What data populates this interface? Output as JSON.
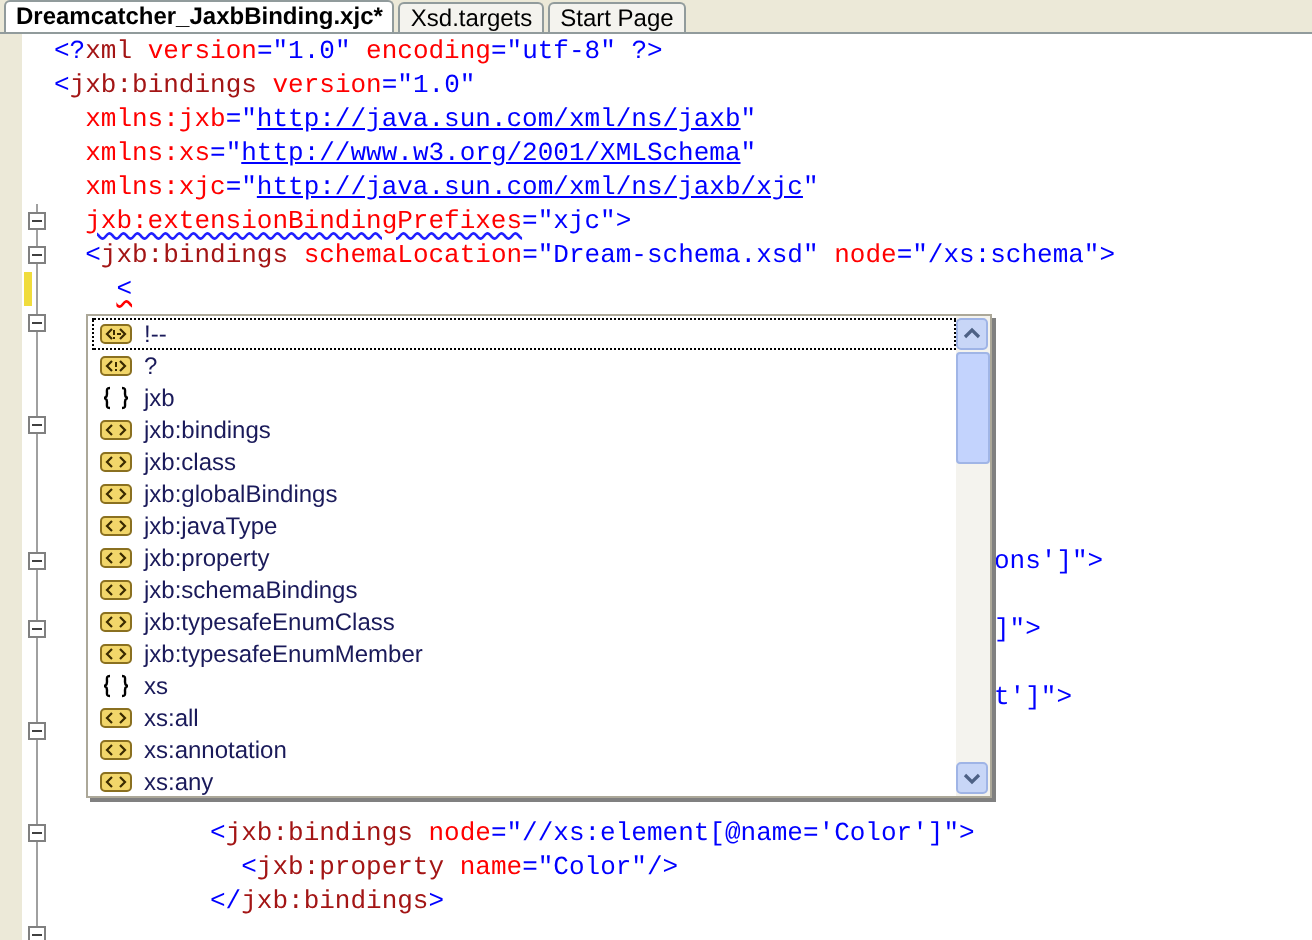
{
  "tabs": [
    {
      "label": "Dreamcatcher_JaxbBinding.xjc*",
      "selected": true
    },
    {
      "label": "Xsd.targets",
      "selected": false
    },
    {
      "label": "Start Page",
      "selected": false
    }
  ],
  "lines": [
    {
      "kind": "top",
      "tokens": [
        {
          "kind": "delim",
          "text": "<?"
        },
        {
          "kind": "name",
          "text": "xml"
        },
        {
          "kind": "attr",
          "text": " version"
        },
        {
          "kind": "value",
          "text": "=\"1.0\""
        },
        {
          "kind": "attr",
          "text": " encoding"
        },
        {
          "kind": "value",
          "text": "=\"utf-8\""
        },
        {
          "kind": "delim",
          "text": " ?>"
        }
      ]
    },
    {
      "kind": "top",
      "tokens": [
        {
          "kind": "delim",
          "text": "<"
        },
        {
          "kind": "name",
          "text": "jxb:bindings"
        },
        {
          "kind": "attr",
          "text": " version"
        },
        {
          "kind": "value",
          "text": "=\"1.0\""
        }
      ]
    },
    {
      "kind": "attr",
      "tokens": [
        {
          "kind": "attr",
          "text": "xmlns:jxb"
        },
        {
          "kind": "value",
          "text": "=\""
        },
        {
          "kind": "link",
          "text": "http://java.sun.com/xml/ns/jaxb"
        },
        {
          "kind": "value",
          "text": "\""
        }
      ]
    },
    {
      "kind": "attr",
      "tokens": [
        {
          "kind": "attr",
          "text": "xmlns:xs"
        },
        {
          "kind": "value",
          "text": "=\""
        },
        {
          "kind": "link",
          "text": "http://www.w3.org/2001/XMLSchema"
        },
        {
          "kind": "value",
          "text": "\""
        }
      ]
    },
    {
      "kind": "attr",
      "tokens": [
        {
          "kind": "attr",
          "text": "xmlns:xjc"
        },
        {
          "kind": "value",
          "text": "=\""
        },
        {
          "kind": "link",
          "text": "http://java.sun.com/xml/ns/jaxb/xjc"
        },
        {
          "kind": "value",
          "text": "\""
        }
      ]
    },
    {
      "fold": true,
      "kind": "attr",
      "tokens": [
        {
          "kind": "attr",
          "text": "jxb:extensionBindingPrefixes",
          "warning": true
        },
        {
          "kind": "value",
          "text": "=\"xjc\""
        },
        {
          "kind": "delim",
          "text": ">"
        }
      ]
    },
    {
      "fold": true,
      "kind": "attr",
      "tokens": [
        {
          "kind": "delim",
          "text": "<"
        },
        {
          "kind": "name",
          "text": "jxb:bindings"
        },
        {
          "kind": "attr",
          "text": " schemaLocation"
        },
        {
          "kind": "value",
          "text": "=\"Dream-schema.xsd\""
        },
        {
          "kind": "attr",
          "text": " node"
        },
        {
          "kind": "value",
          "text": "=\"/xs:schema\""
        },
        {
          "kind": "delim",
          "text": ">"
        }
      ]
    },
    {
      "fold": false,
      "changed": true,
      "kind": "inner",
      "tokens": [
        {
          "kind": "delim",
          "text": "<",
          "error": true
        }
      ]
    },
    {
      "fold": true
    },
    {
      "fold": false
    },
    {
      "fold": false
    },
    {
      "fold": true
    },
    {
      "fold": false
    },
    {
      "fold": false
    },
    {
      "fold": false
    },
    {
      "fold": true,
      "kind": "tail",
      "tokens": [
        {
          "kind": "value",
          "text": "ons']\">"
        }
      ]
    },
    {
      "fold": false
    },
    {
      "fold": true,
      "kind": "tail",
      "tokens": [
        {
          "kind": "value",
          "text": "]\">"
        }
      ]
    },
    {
      "fold": false
    },
    {
      "fold": false,
      "kind": "tail",
      "tokens": [
        {
          "kind": "value",
          "text": "t']\">"
        }
      ]
    },
    {
      "fold": true
    },
    {
      "fold": false
    },
    {
      "fold": false
    },
    {
      "fold": true,
      "kind": "child",
      "tokens": [
        {
          "kind": "delim",
          "text": "<"
        },
        {
          "kind": "name",
          "text": "jxb:bindings"
        },
        {
          "kind": "attr",
          "text": " node"
        },
        {
          "kind": "value",
          "text": "=\"//xs:element[@name='Color']\""
        },
        {
          "kind": "delim",
          "text": ">"
        }
      ]
    },
    {
      "fold": false,
      "kind": "grandchild",
      "tokens": [
        {
          "kind": "delim",
          "text": "<"
        },
        {
          "kind": "name",
          "text": "jxb:property"
        },
        {
          "kind": "attr",
          "text": " name"
        },
        {
          "kind": "value",
          "text": "=\"Color\""
        },
        {
          "kind": "delim",
          "text": "/>"
        }
      ]
    },
    {
      "fold": false,
      "kind": "child",
      "tokens": [
        {
          "kind": "delim",
          "text": "</"
        },
        {
          "kind": "name",
          "text": "jxb:bindings"
        },
        {
          "kind": "delim",
          "text": ">"
        }
      ]
    },
    {
      "fold": true
    }
  ],
  "completion": [
    {
      "kind": "comment",
      "label": "!--",
      "selected": true
    },
    {
      "kind": "pi",
      "label": "?",
      "selected": false
    },
    {
      "kind": "namespace",
      "label": "jxb",
      "selected": false
    },
    {
      "kind": "element",
      "label": "jxb:bindings",
      "selected": false
    },
    {
      "kind": "element",
      "label": "jxb:class",
      "selected": false
    },
    {
      "kind": "element",
      "label": "jxb:globalBindings",
      "selected": false
    },
    {
      "kind": "element",
      "label": "jxb:javaType",
      "selected": false
    },
    {
      "kind": "element",
      "label": "jxb:property",
      "selected": false
    },
    {
      "kind": "element",
      "label": "jxb:schemaBindings",
      "selected": false
    },
    {
      "kind": "element",
      "label": "jxb:typesafeEnumClass",
      "selected": false
    },
    {
      "kind": "element",
      "label": "jxb:typesafeEnumMember",
      "selected": false
    },
    {
      "kind": "namespace",
      "label": "xs",
      "selected": false
    },
    {
      "kind": "element",
      "label": "xs:all",
      "selected": false
    },
    {
      "kind": "element",
      "label": "xs:annotation",
      "selected": false
    },
    {
      "kind": "element",
      "label": "xs:any",
      "selected": false
    }
  ]
}
